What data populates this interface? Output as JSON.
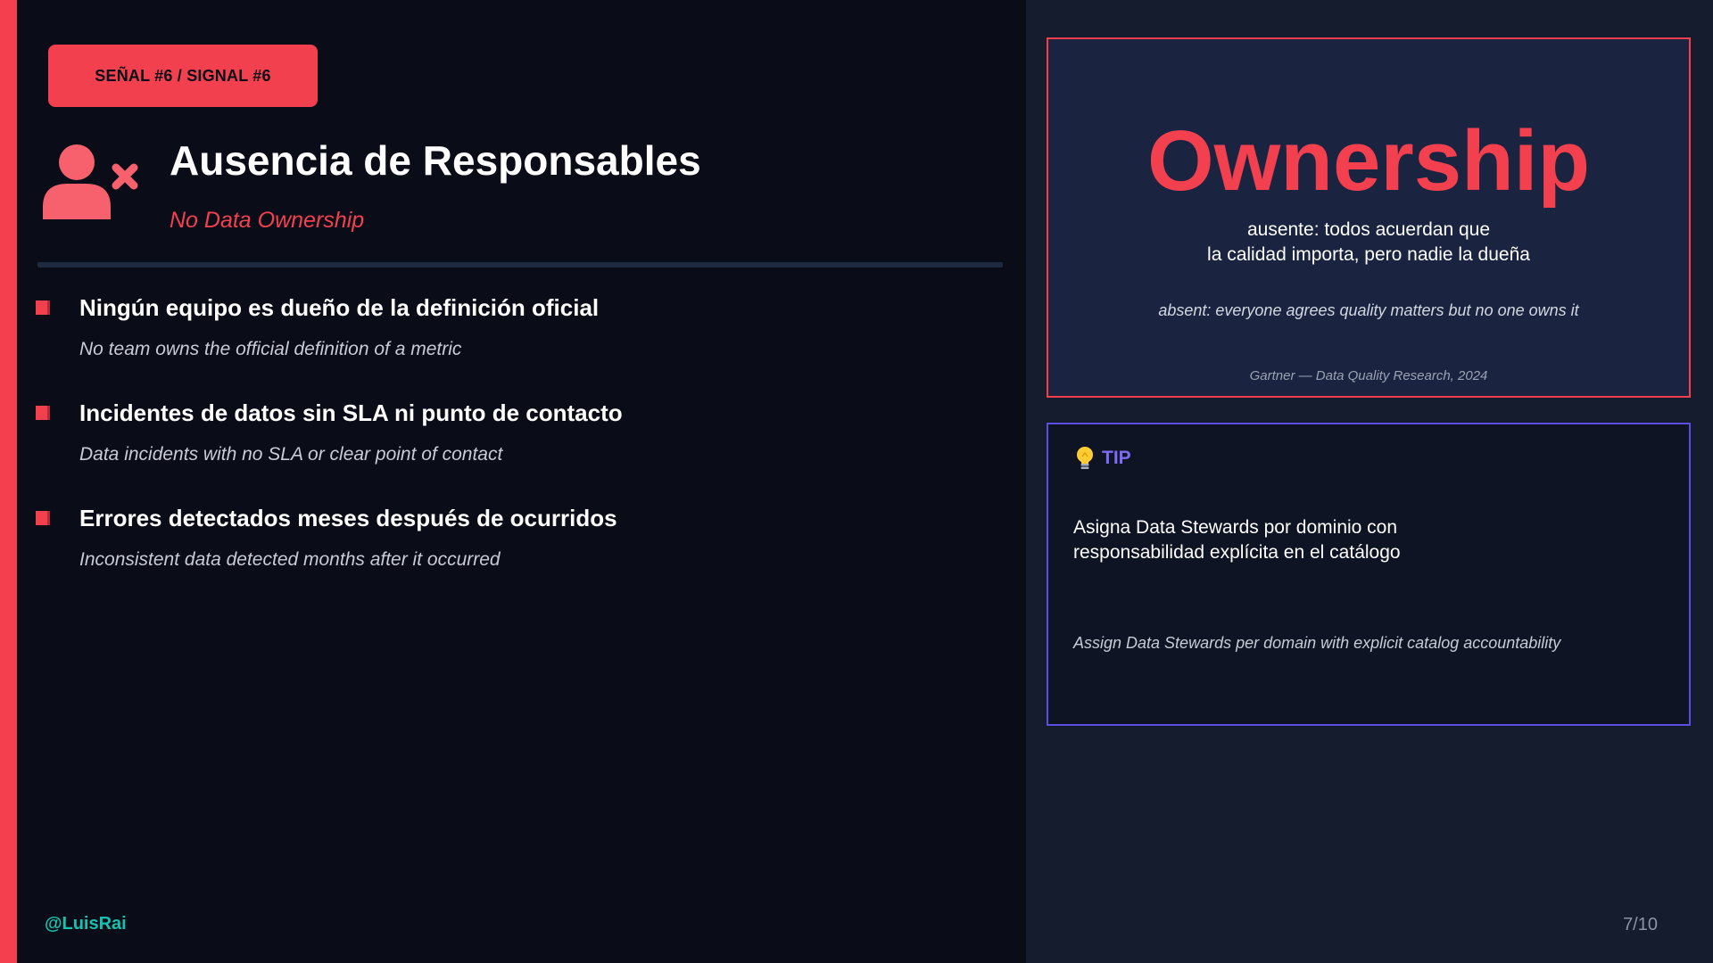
{
  "badge": {
    "label": "SEÑAL #6 / SIGNAL #6"
  },
  "header": {
    "icon": "user-x-icon",
    "title": "Ausencia de Responsables",
    "subtitle": "No Data Ownership"
  },
  "bullets": [
    {
      "es": "Ningún equipo es dueño de la definición oficial",
      "en": "No team owns the official definition of a metric"
    },
    {
      "es": "Incidentes de datos sin SLA ni punto de contacto",
      "en": "Data incidents with no SLA or clear point of contact"
    },
    {
      "es": "Errores detectados meses después de ocurridos",
      "en": "Inconsistent data detected months after it occurred"
    }
  ],
  "stat_card": {
    "big_word": "Ownership",
    "es_lines": [
      "ausente: todos acuerdan que",
      "la calidad importa, pero nadie la dueña"
    ],
    "en": "absent: everyone agrees quality matters but no one owns it",
    "source": "Gartner — Data Quality Research, 2024"
  },
  "tip_card": {
    "icon": "lightbulb-icon",
    "label": "TIP",
    "es_lines": [
      "Asigna Data Stewards por dominio con",
      "responsabilidad explícita en el catálogo"
    ],
    "en": "Assign Data Stewards per domain with explicit catalog accountability"
  },
  "footer": {
    "handle": "@LuisRai",
    "page": "7/10"
  },
  "colors": {
    "accent": "#f2404f",
    "background": "#0a0d17",
    "panel": "#141c2e",
    "tip_border": "#5b4ee0",
    "handle": "#13c2b0"
  }
}
